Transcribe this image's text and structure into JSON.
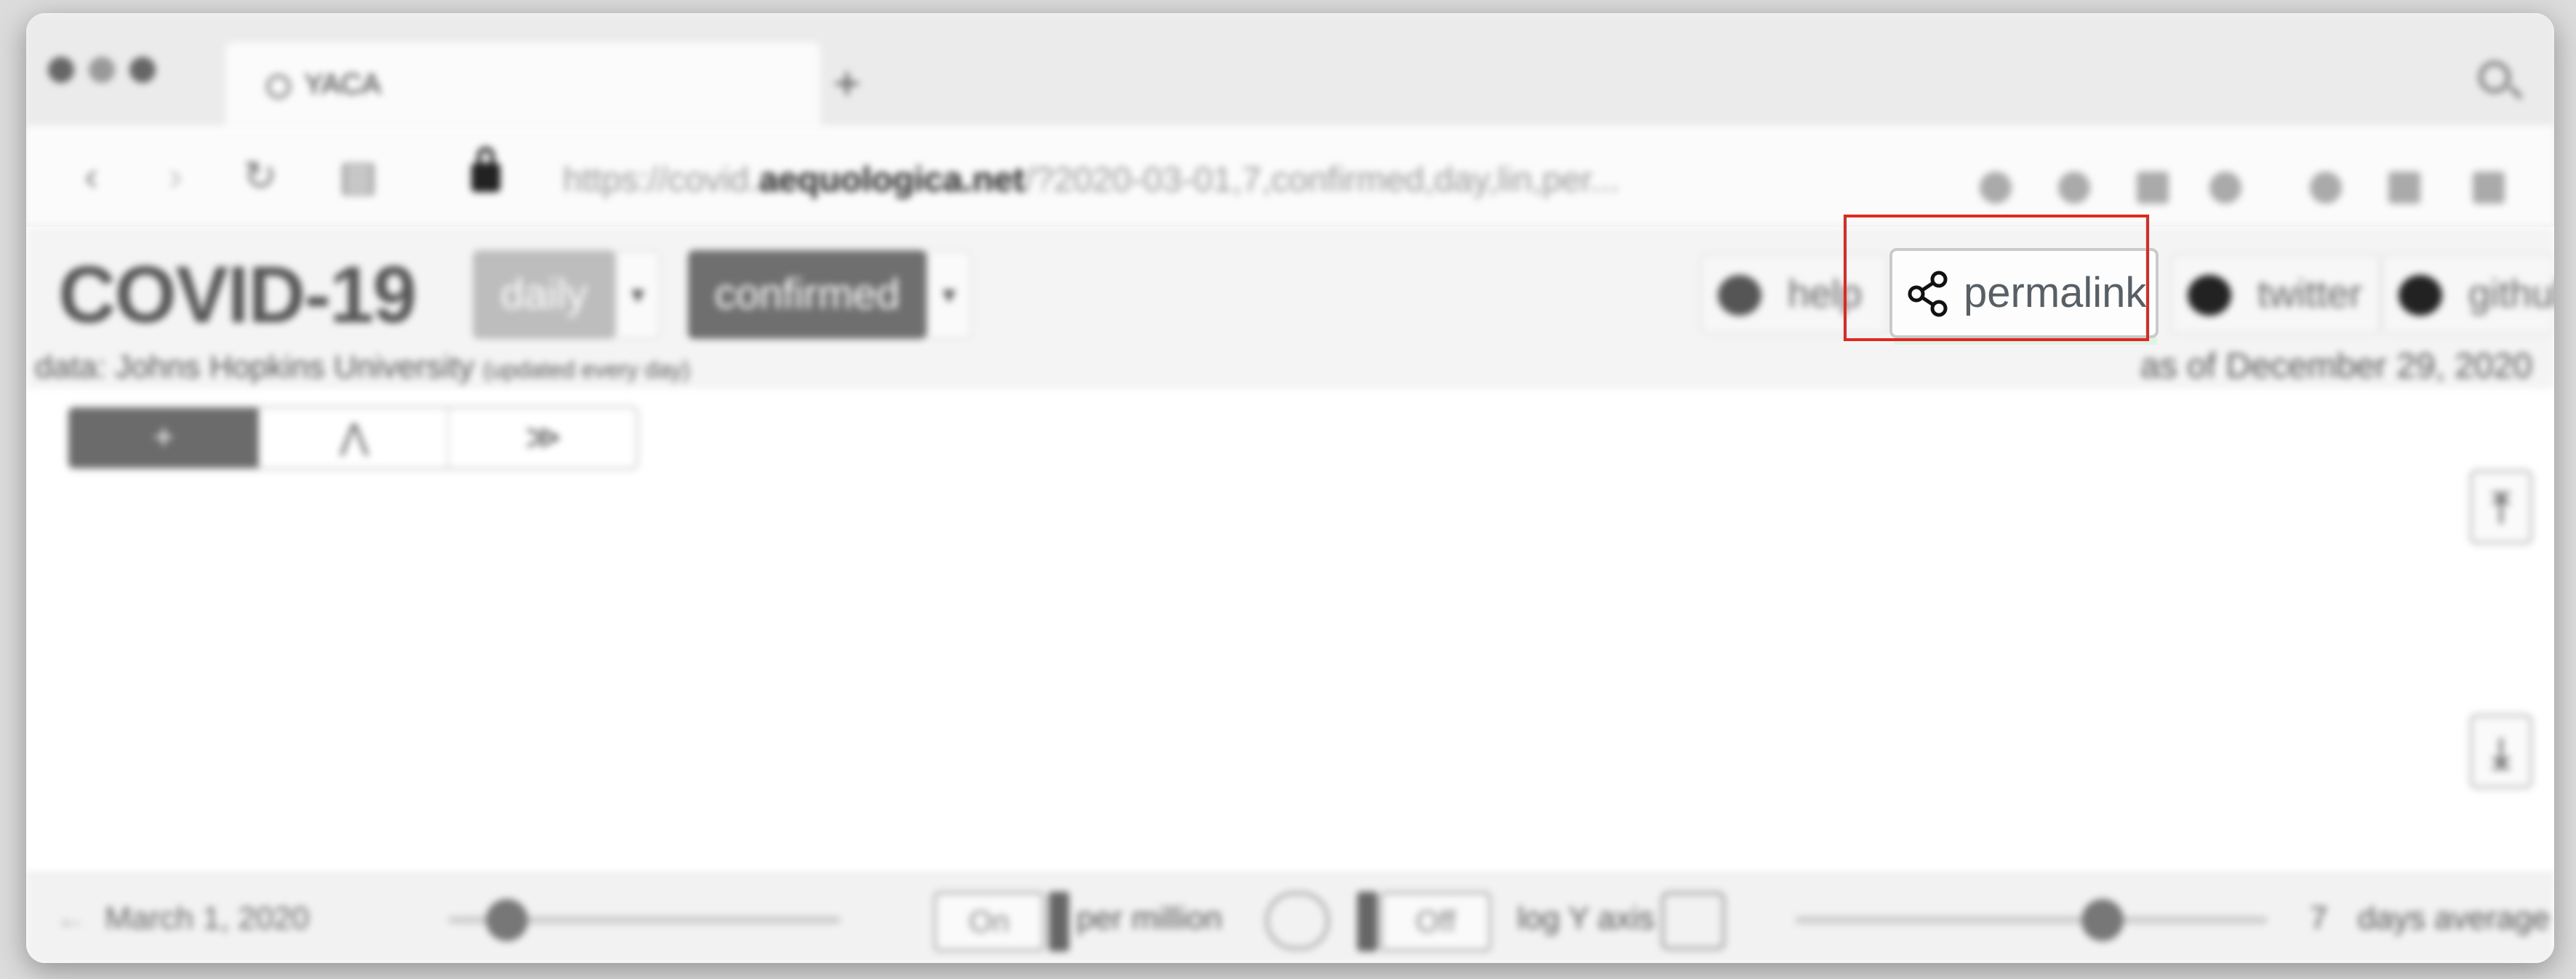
{
  "browser": {
    "tab_title": "YACA",
    "new_tab": "+",
    "url_prefix": "https://covid.",
    "url_domain": "aequologica.net",
    "url_rest": "/?2020-03-01,7,confirmed,day,lin,per...",
    "nav": {
      "back": "‹",
      "forward": "›",
      "reload": "↻",
      "reader": "▤"
    }
  },
  "header": {
    "app_name": "COVID-19",
    "period_dropdown": "daily",
    "metric_dropdown": "confirmed",
    "caret": "▾",
    "help_label": "help",
    "permalink_label": "permalink",
    "twitter_label": "twitter",
    "github_label": "github",
    "data_source": "data: Johns Hopkins University",
    "data_note": "(updated every day)",
    "as_of": "as of December 29, 2020"
  },
  "segmented": {
    "items": [
      "+",
      "⋀",
      "≫"
    ]
  },
  "side_buttons": {
    "up": "⤒",
    "down": "⤓"
  },
  "bottom": {
    "start_arrow": "←",
    "start_date": "March 1, 2020",
    "date_slider_level": 0.15,
    "per_million_state": "On",
    "per_million_label": "per million",
    "log_state": "Off",
    "log_label": "log Y axis",
    "average_slider_level": 0.65,
    "average_value": "7",
    "average_label": "days average"
  },
  "colors": {
    "focus_box": "#e0281e",
    "permalink_text": "#586065",
    "dropdown_fill": "#bdbdbd",
    "metric_fill": "#6f6f6f"
  }
}
